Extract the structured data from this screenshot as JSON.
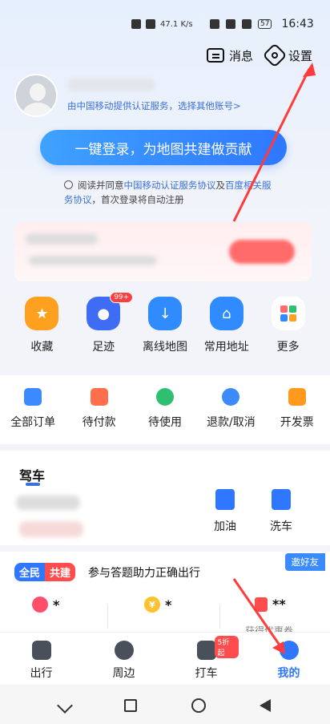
{
  "status_bar": {
    "speed": "47.1 K/s",
    "battery": "57",
    "time": "16:43"
  },
  "top_actions": {
    "message_label": "消息",
    "settings_label": "设置"
  },
  "profile": {
    "subtitle": "由中国移动提供认证服务，选择其他账号>"
  },
  "login": {
    "button_label": "一键登录，为地图共建做贡献"
  },
  "agreement": {
    "prefix": "阅读并同意",
    "link1": "中国移动认证服务协议",
    "mid": "及",
    "link2": "百度相关服务协议",
    "suffix": "，首次登录将自动注册"
  },
  "quick_actions": [
    {
      "label": "收藏",
      "icon": "star-icon",
      "color": "#ff9a1f"
    },
    {
      "label": "足迹",
      "icon": "footprint-icon",
      "color": "#3f6cf5",
      "badge": "99+"
    },
    {
      "label": "离线地图",
      "icon": "cloud-download-icon",
      "color": "#2f8bff"
    },
    {
      "label": "常用地址",
      "icon": "home-star-icon",
      "color": "#2f8bff"
    },
    {
      "label": "更多",
      "icon": "grid-icon",
      "color": "#ffffff"
    }
  ],
  "orders": [
    {
      "label": "全部订单",
      "icon": "orders-icon",
      "color": "#3b8bff"
    },
    {
      "label": "待付款",
      "icon": "wallet-icon",
      "color": "#ff6f4d"
    },
    {
      "label": "待使用",
      "icon": "clock-icon",
      "color": "#2fbf71"
    },
    {
      "label": "退款/取消",
      "icon": "refund-icon",
      "color": "#3b8bff"
    },
    {
      "label": "开发票",
      "icon": "invoice-icon",
      "color": "#ff9a1f"
    }
  ],
  "drive": {
    "title": "驾车",
    "actions": [
      {
        "label": "加油",
        "icon": "fuel-icon"
      },
      {
        "label": "洗车",
        "icon": "car-wash-icon"
      }
    ]
  },
  "quiz": {
    "tag1": "全民",
    "tag2": "共建",
    "title": "参与答题助力正确出行",
    "invite": "邀好友",
    "item1_value": "*",
    "item2_value": "*",
    "item3_value": "**",
    "item3_sub": "获得优惠券",
    "coin_symbol": "¥"
  },
  "tabbar": [
    {
      "label": "出行",
      "icon": "travel-icon"
    },
    {
      "label": "周边",
      "icon": "compass-icon"
    },
    {
      "label": "打车",
      "icon": "taxi-icon",
      "badge": "5折起"
    },
    {
      "label": "我的",
      "icon": "profile-icon",
      "active": true
    }
  ]
}
